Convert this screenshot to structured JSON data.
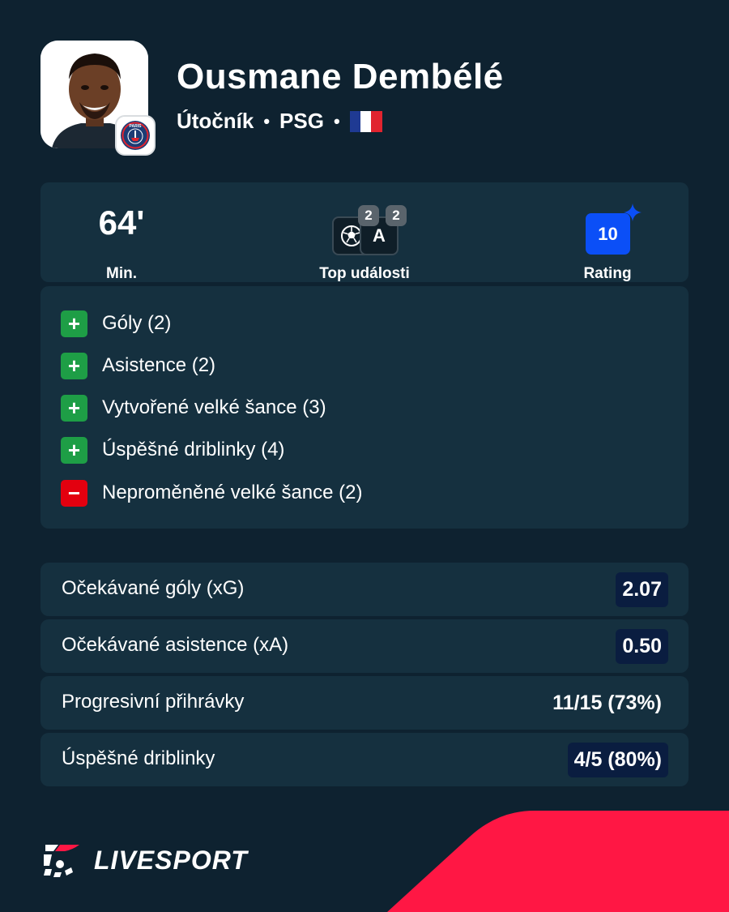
{
  "player": {
    "name": "Ousmane Dembélé",
    "position": "Útočník",
    "club": "PSG",
    "separator": "•",
    "club_badge_text": "PARIS"
  },
  "summary": {
    "minutes": {
      "value": "64'",
      "label": "Min."
    },
    "top_events": {
      "label": "Top události",
      "goals_count": "2",
      "assists_count": "2",
      "assist_letter": "A"
    },
    "rating": {
      "value": "10",
      "label": "Rating"
    }
  },
  "highlights": [
    {
      "sign": "+",
      "type": "plus",
      "text": "Góly (2)"
    },
    {
      "sign": "+",
      "type": "plus",
      "text": "Asistence (2)"
    },
    {
      "sign": "+",
      "type": "plus",
      "text": "Vytvořené velké šance (3)"
    },
    {
      "sign": "+",
      "type": "plus",
      "text": "Úspěšné driblinky (4)"
    },
    {
      "sign": "−",
      "type": "minus",
      "text": "Neproměněné velké šance (2)"
    }
  ],
  "stats": [
    {
      "label": "Očekávané góly (xG)",
      "value": "2.07",
      "boxed": true
    },
    {
      "label": "Očekávané asistence (xA)",
      "value": "0.50",
      "boxed": true
    },
    {
      "label": "Progresivní přihrávky",
      "value": "11/15 (73%)",
      "boxed": false
    },
    {
      "label": "Úspěšné driblinky",
      "value": "4/5 (80%)",
      "boxed": true
    }
  ],
  "brand": {
    "name": "LIVESPORT"
  },
  "colors": {
    "background": "#0e2230",
    "panel": "#15303f",
    "positive": "#1e9e46",
    "negative": "#e3000f",
    "rating": "#0b4ff7",
    "accent_red": "#ff1744",
    "flag_blue": "#1f3a93",
    "flag_white": "#ffffff",
    "flag_red": "#e1242f"
  },
  "icons": {
    "goal": "football-icon",
    "rating_star": "sparkle-star-icon",
    "flag": "france-flag-icon",
    "club": "psg-crest-icon",
    "brand": "livesport-logo-icon"
  }
}
